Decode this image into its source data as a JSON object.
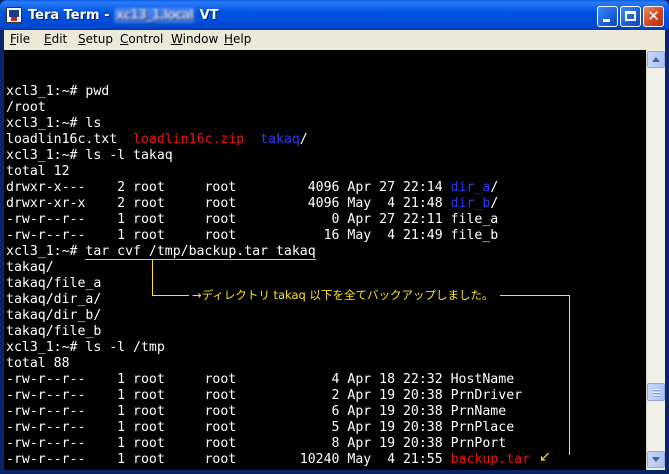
{
  "window": {
    "title_app": "Tera Term",
    "title_sep": " - ",
    "title_host": "xc13_1.local",
    "title_suffix": " VT"
  },
  "menu": {
    "items": [
      {
        "hotkey": "F",
        "rest": "ile"
      },
      {
        "hotkey": "E",
        "rest": "dit"
      },
      {
        "hotkey": "S",
        "rest": "etup"
      },
      {
        "hotkey": "C",
        "rest": "ontrol"
      },
      {
        "hotkey": "W",
        "rest": "indow"
      },
      {
        "hotkey": "H",
        "rest": "elp"
      }
    ]
  },
  "terminal": {
    "lines": [
      "xcl3_1:~# pwd",
      "/root",
      "xcl3_1:~# ls",
      "xcl3_1:~# ls -l takaq",
      "total 12",
      "drwxr-x---    2 root     root         4096 Apr 27 22:14 ",
      "drwxr-xr-x    2 root     root         4096 May  4 21:48 ",
      "-rw-r--r--    1 root     root            0 Apr 27 22:11 file_a",
      "-rw-r--r--    1 root     root           16 May  4 21:49 file_b",
      "xcl3_1:~# ",
      "takaq/",
      "takaq/file_a",
      "takaq/dir_a/",
      "takaq/dir_b/",
      "takaq/file_b",
      "xcl3_1:~# ls -l /tmp",
      "total 88",
      "-rw-r--r--    1 root     root            4 Apr 18 22:32 HostName",
      "-rw-r--r--    1 root     root            2 Apr 19 20:38 PrnDriver",
      "-rw-r--r--    1 root     root            6 Apr 19 20:38 PrnName",
      "-rw-r--r--    1 root     root            5 Apr 19 20:38 PrnPlace",
      "-rw-r--r--    1 root     root            8 Apr 19 20:38 PrnPort",
      "-rw-r--r--    1 root     root        10240 May  4 21:55 "
    ],
    "ls_out": {
      "file1": "loadlin16c.txt  ",
      "file2": "loadlin16c.zip  ",
      "dir": "takaq",
      "slash": "/"
    },
    "dir_a": "dir_a",
    "dir_b": "dir_b",
    "tar_cmd": "tar cvf /tmp/backup.tar takaq",
    "backup_file": "backup.tar",
    "dir_slash": "/"
  },
  "annotation": {
    "text": "ディレクトリ takaq 以下を全てバックアップしました。"
  },
  "colors": {
    "red": "#ee1111",
    "blue": "#2b3bff",
    "annotation": "#ffe21a"
  }
}
